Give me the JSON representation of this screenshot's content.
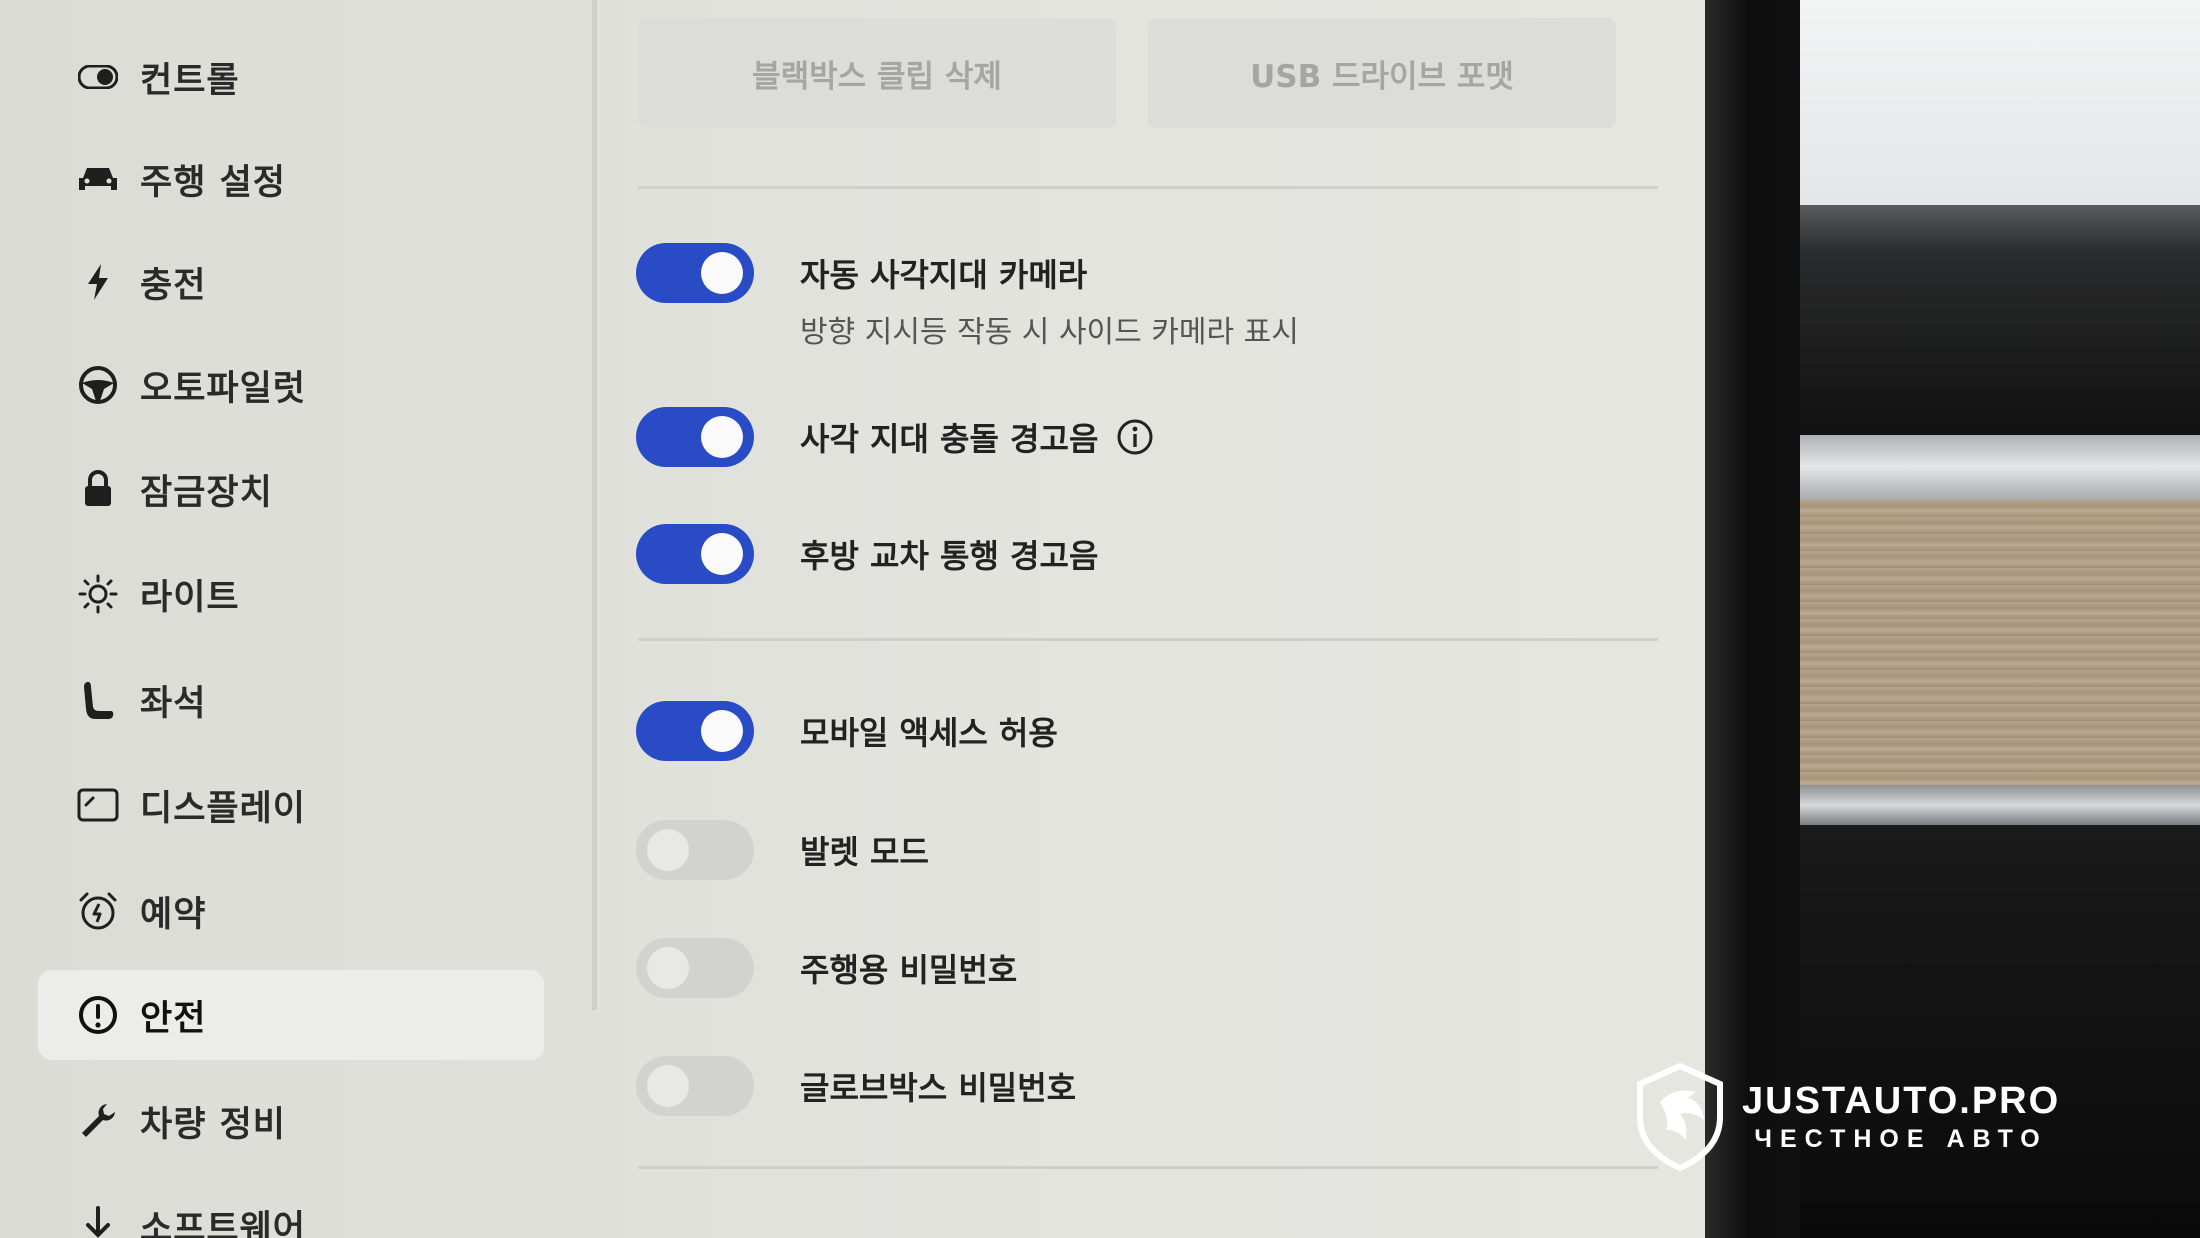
{
  "sidebar": {
    "items": [
      {
        "label": "컨트롤",
        "icon": "toggle-icon"
      },
      {
        "label": "주행 설정",
        "icon": "car-icon"
      },
      {
        "label": "충전",
        "icon": "lightning-icon"
      },
      {
        "label": "오토파일럿",
        "icon": "steering-wheel-icon"
      },
      {
        "label": "잠금장치",
        "icon": "lock-icon"
      },
      {
        "label": "라이트",
        "icon": "sun-icon"
      },
      {
        "label": "좌석",
        "icon": "seat-icon"
      },
      {
        "label": "디스플레이",
        "icon": "display-icon"
      },
      {
        "label": "예약",
        "icon": "alarm-clock-icon"
      },
      {
        "label": "안전",
        "icon": "alert-circle-icon",
        "active": true
      },
      {
        "label": "차량 정비",
        "icon": "wrench-icon"
      },
      {
        "label": "소프트웨어",
        "icon": "download-icon"
      }
    ]
  },
  "main": {
    "buttons": {
      "delete_dashcam": "블랙박스 클립 삭제",
      "format_usb": "USB 드라이브 포맷"
    },
    "settings": [
      {
        "title": "자동 사각지대 카메라",
        "subtitle": "방향 지시등 작동 시 사이드 카메라 표시",
        "on": true
      },
      {
        "title": "사각 지대 충돌 경고음",
        "on": true,
        "info": true
      },
      {
        "title": "후방 교차 통행 경고음",
        "on": true
      },
      {
        "title": "모바일 액세스 허용",
        "on": true
      },
      {
        "title": "발렛 모드",
        "on": false
      },
      {
        "title": "주행용 비밀번호",
        "on": false
      },
      {
        "title": "글로브박스 비밀번호",
        "on": false
      }
    ]
  },
  "watermark": {
    "brand": "JUSTAUTO.PRO",
    "tagline": "ЧЕСТНОЕ АВТО"
  },
  "colors": {
    "toggle_on": "#2a4bc6",
    "toggle_off": "#d2d2ce",
    "screen_bg": "#e3e3de"
  }
}
